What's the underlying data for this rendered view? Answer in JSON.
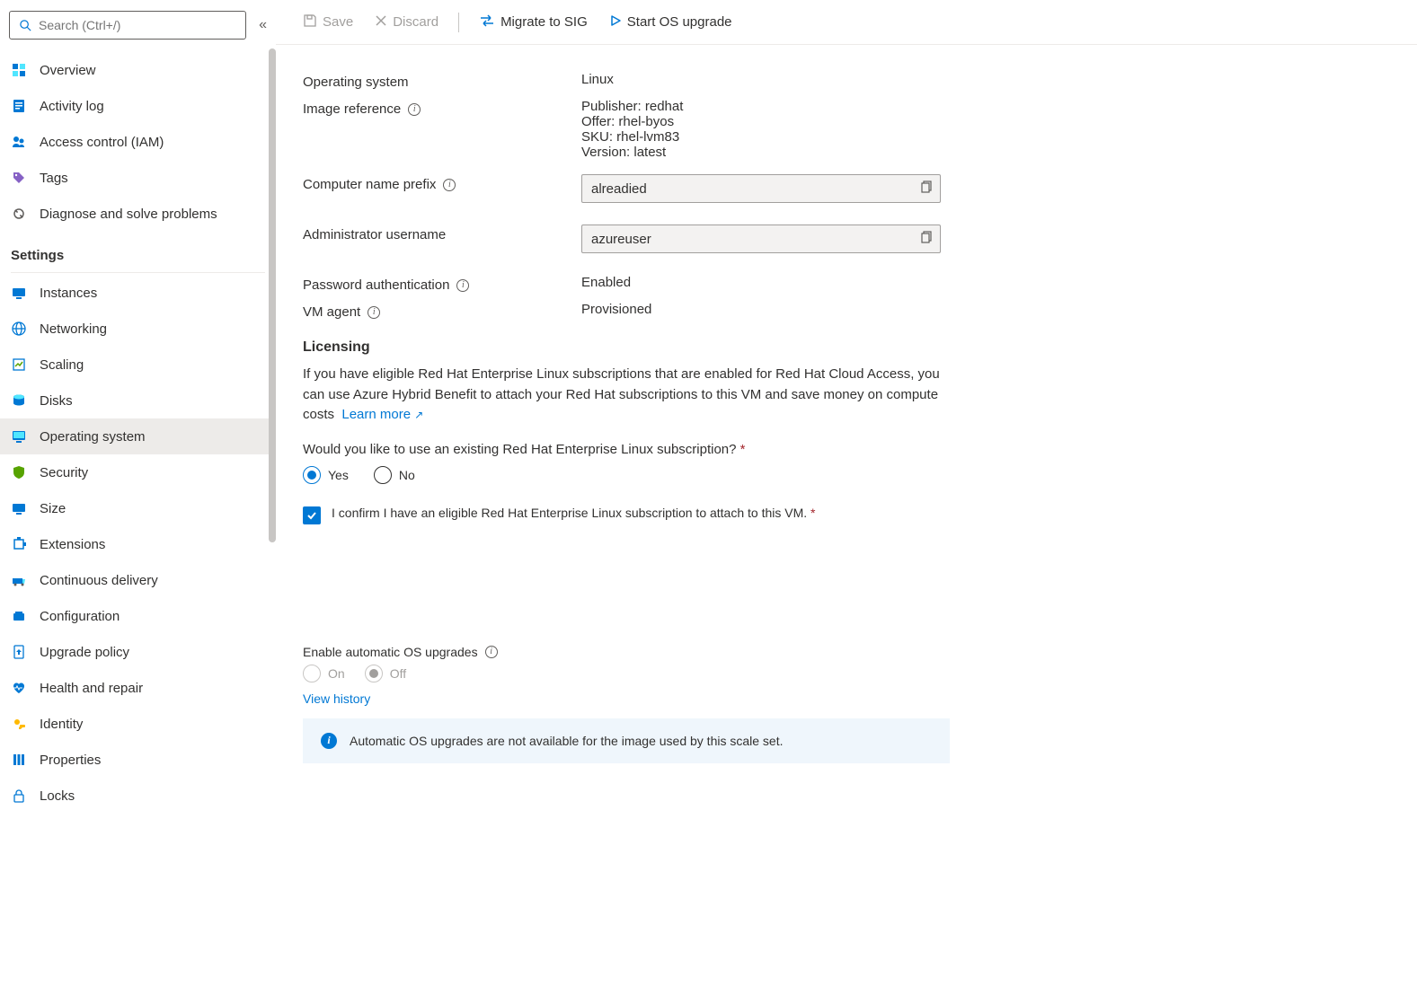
{
  "search": {
    "placeholder": "Search (Ctrl+/)"
  },
  "sidebar": {
    "top_items": [
      {
        "label": "Overview"
      },
      {
        "label": "Activity log"
      },
      {
        "label": "Access control (IAM)"
      },
      {
        "label": "Tags"
      },
      {
        "label": "Diagnose and solve problems"
      }
    ],
    "settings_header": "Settings",
    "settings_items": [
      {
        "label": "Instances"
      },
      {
        "label": "Networking"
      },
      {
        "label": "Scaling"
      },
      {
        "label": "Disks"
      },
      {
        "label": "Operating system"
      },
      {
        "label": "Security"
      },
      {
        "label": "Size"
      },
      {
        "label": "Extensions"
      },
      {
        "label": "Continuous delivery"
      },
      {
        "label": "Configuration"
      },
      {
        "label": "Upgrade policy"
      },
      {
        "label": "Health and repair"
      },
      {
        "label": "Identity"
      },
      {
        "label": "Properties"
      },
      {
        "label": "Locks"
      }
    ]
  },
  "toolbar": {
    "save": "Save",
    "discard": "Discard",
    "migrate": "Migrate to SIG",
    "start_upgrade": "Start OS upgrade"
  },
  "details": {
    "os_label": "Operating system",
    "os_value": "Linux",
    "image_ref_label": "Image reference",
    "image_ref_lines": [
      "Publisher: redhat",
      "Offer: rhel-byos",
      "SKU: rhel-lvm83",
      "Version: latest"
    ],
    "prefix_label": "Computer name prefix",
    "prefix_value": "alreadied",
    "admin_label": "Administrator username",
    "admin_value": "azureuser",
    "pwauth_label": "Password authentication",
    "pwauth_value": "Enabled",
    "vmagent_label": "VM agent",
    "vmagent_value": "Provisioned"
  },
  "licensing": {
    "header": "Licensing",
    "paragraph": "If you have eligible Red Hat Enterprise Linux subscriptions that are enabled for Red Hat Cloud Access, you can use Azure Hybrid Benefit to attach your Red Hat subscriptions to this VM and save money on compute costs",
    "learn_more": "Learn more",
    "question": "Would you like to use an existing Red Hat Enterprise Linux subscription?",
    "yes": "Yes",
    "no": "No",
    "confirm": "I confirm I have an eligible Red Hat Enterprise Linux subscription to attach to this VM."
  },
  "upgrades": {
    "enable_label": "Enable automatic OS upgrades",
    "on": "On",
    "off": "Off",
    "view_history": "View history",
    "banner": "Automatic OS upgrades are not available for the image used by this scale set."
  }
}
